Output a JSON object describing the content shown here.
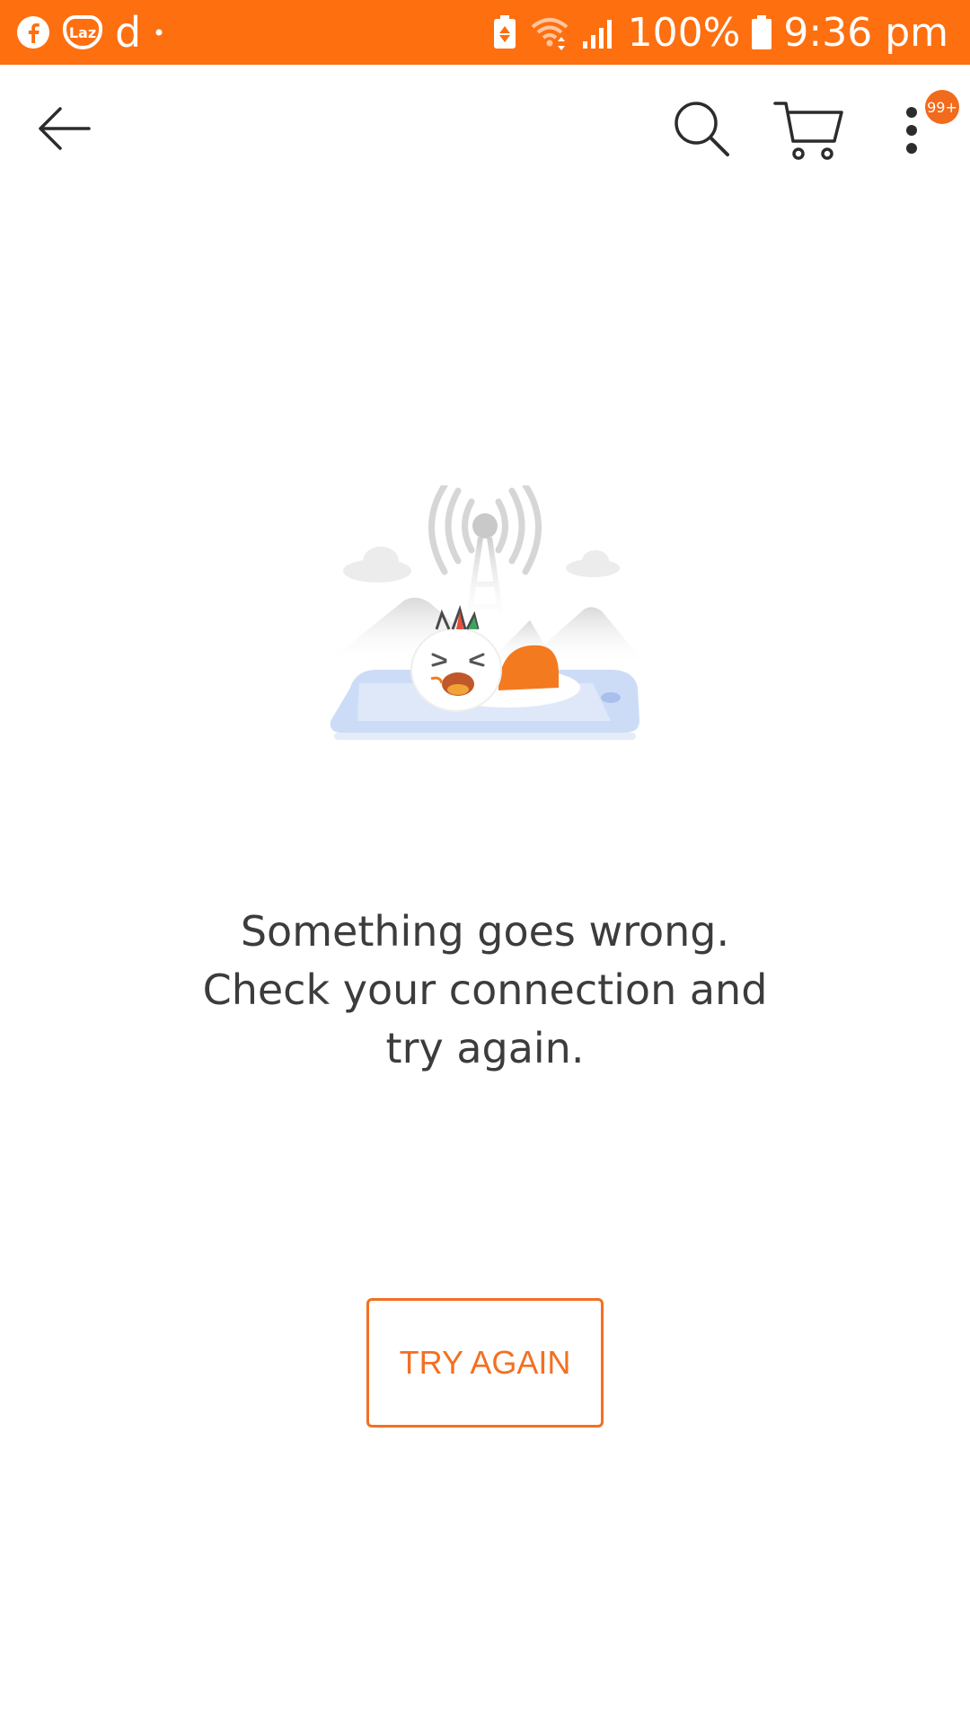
{
  "status_bar": {
    "notification_icons": [
      "facebook-icon",
      "lazada-icon",
      "d-app-icon",
      "dot-icon"
    ],
    "laz_badge_text": "Laz",
    "d_glyph": "d",
    "battery_percent": "100%",
    "time": "9:36 pm",
    "background_color": "#fe6f10"
  },
  "app_bar": {
    "icons": [
      "back-arrow-icon",
      "search-icon",
      "cart-icon",
      "more-vertical-icon"
    ],
    "notification_badge": "99+",
    "badge_color": "#f26a1b"
  },
  "error": {
    "illustration": "no-connection-illustration",
    "message_lines": [
      "Something goes wrong.",
      "Check your connection and",
      "try again."
    ],
    "text_color": "#3c3c3c"
  },
  "try_again_button": {
    "label": "TRY AGAIN",
    "accent_color": "#f37021"
  }
}
